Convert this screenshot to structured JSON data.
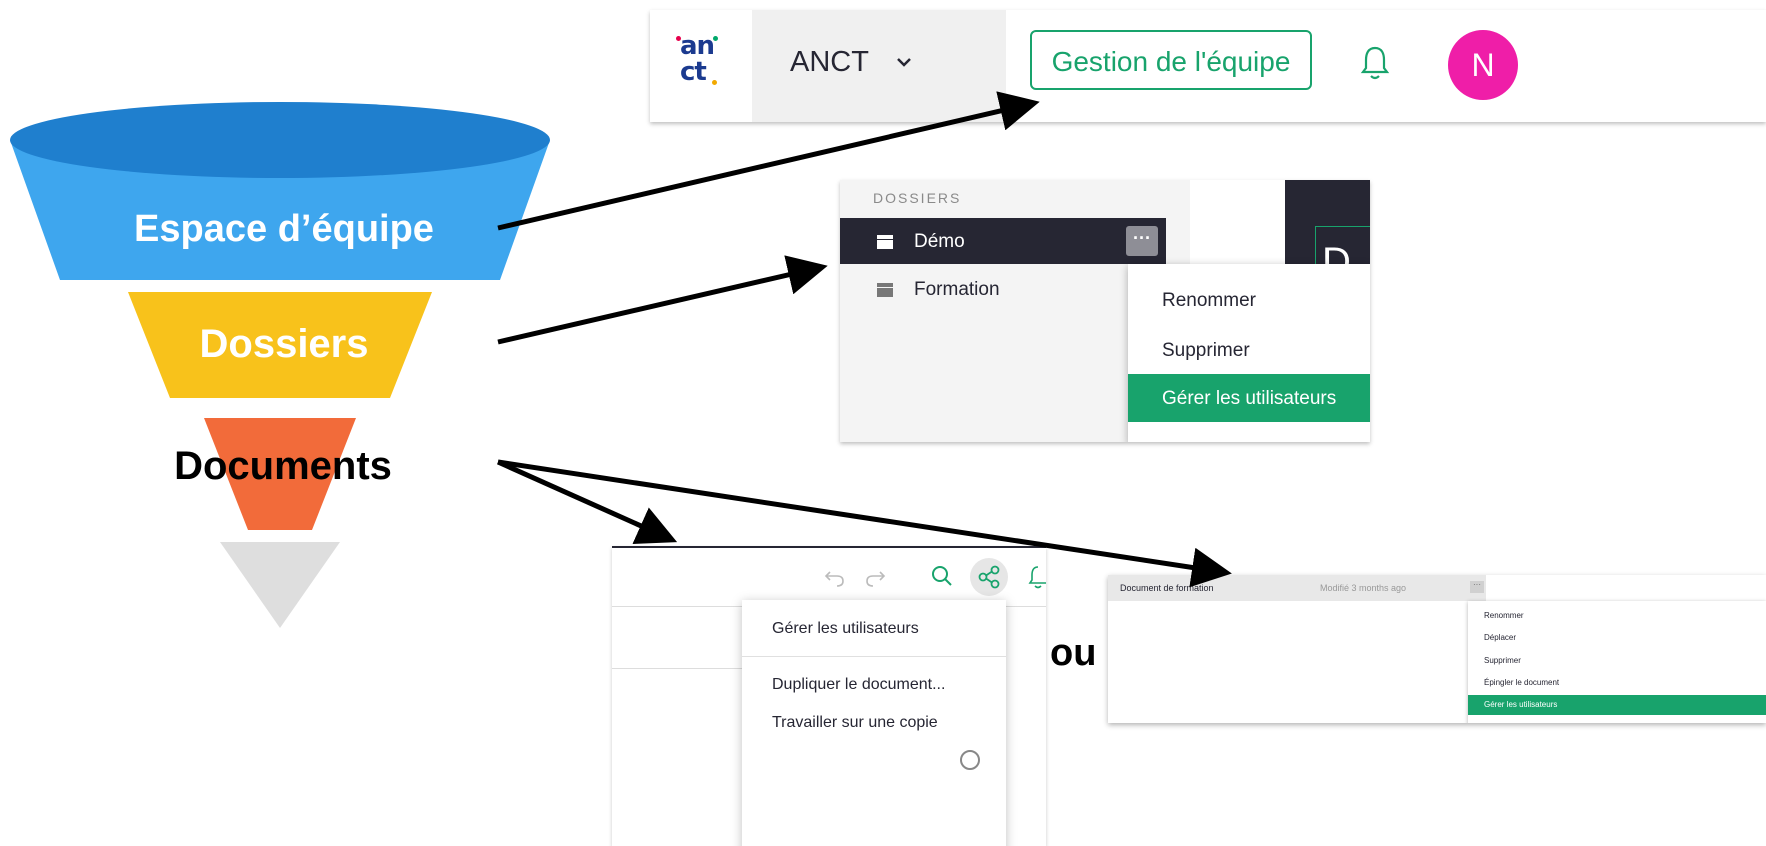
{
  "funnel": {
    "level1": "Espace d’équipe",
    "level2": "Dossiers",
    "level3": "Documents"
  },
  "topbar": {
    "logo_top": "an",
    "logo_bottom": "ct",
    "org_name": "ANCT",
    "team_button": "Gestion de l'équipe",
    "avatar_initial": "N"
  },
  "folders": {
    "header": "DOSSIERS",
    "items": [
      "Démo",
      "Formation"
    ],
    "more_label": "···",
    "menu": [
      "Renommer",
      "Supprimer",
      "Gérer les utilisateurs"
    ],
    "partial_title": "D"
  },
  "document_menu": {
    "items": [
      "Gérer les utilisateurs",
      "Dupliquer le document...",
      "Travailler sur une copie"
    ]
  },
  "connector": "ou",
  "doc_list": {
    "document_name": "Document de formation",
    "modified": "Modifié 3 months ago",
    "more_label": "···",
    "menu": [
      "Renommer",
      "Déplacer",
      "Supprimer",
      "Épingler le document",
      "Gérer les utilisateurs"
    ]
  },
  "colors": {
    "funnel_blue": "#3ea6ee",
    "funnel_blue_top": "#1f7fce",
    "funnel_yellow": "#f8c21b",
    "funnel_orange": "#f26b3a",
    "funnel_grey": "#dedede",
    "accent_green": "#18a36c",
    "dark_navy": "#262633",
    "avatar_pink": "#ef1ea8"
  }
}
